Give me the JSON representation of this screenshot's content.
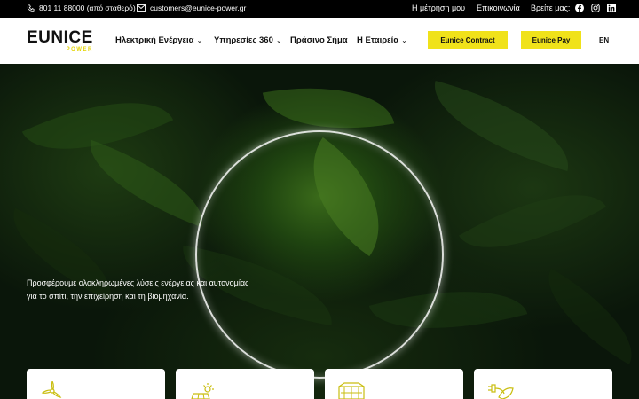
{
  "topbar": {
    "phone": "801 11 88000 (από σταθερό)",
    "email": "customers@eunice-power.gr",
    "meter": "Η μέτρηση μου",
    "contact": "Επικοινωνία",
    "find_us": "Βρείτε μας:",
    "social": [
      "facebook-icon",
      "instagram-icon",
      "linkedin-icon"
    ]
  },
  "header": {
    "logo_main": "EUNICE",
    "logo_sub": "POWER",
    "nav": [
      {
        "label": "Ηλεκτρική Ενέργεια",
        "has_menu": true
      },
      {
        "label": "Υπηρεσίες 360",
        "has_menu": true
      },
      {
        "label": "Πράσινο Σήμα",
        "has_menu": false
      },
      {
        "label": "Η Εταιρεία",
        "has_menu": true
      }
    ],
    "btn_contract": "Eunice Contract",
    "btn_pay": "Eunice Pay",
    "lang": "EN"
  },
  "hero": {
    "text": "Προσφέρουμε ολοκληρωμένες λύσεις ενέργειας και αυτονομίας για το σπίτι, την επιχείρηση και τη βιομηχανία."
  },
  "cards": [
    {
      "icon": "wind-turbine-icon"
    },
    {
      "icon": "solar-panel-icon"
    },
    {
      "icon": "battery-storage-icon"
    },
    {
      "icon": "ev-charging-icon"
    }
  ],
  "colors": {
    "accent": "#f0e21a",
    "topbar_bg": "#000000",
    "header_bg": "#ffffff"
  }
}
